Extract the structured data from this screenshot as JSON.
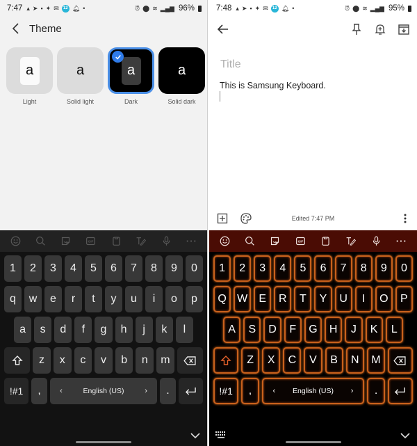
{
  "left": {
    "status_bar": {
      "time": "7:47",
      "battery": "96%"
    },
    "header": {
      "title": "Theme"
    },
    "themes": [
      {
        "label": "Light",
        "preview_char": "a",
        "selected": false
      },
      {
        "label": "Solid light",
        "preview_char": "a",
        "selected": false
      },
      {
        "label": "Dark",
        "preview_char": "a",
        "selected": true
      },
      {
        "label": "Solid dark",
        "preview_char": "a",
        "selected": false
      }
    ],
    "keyboard": {
      "toolbar": [
        "emoji-icon",
        "search-icon",
        "sticker-icon",
        "gif-icon",
        "clipboard-icon",
        "handwriting-icon",
        "mic-icon",
        "more-icon"
      ],
      "rows": [
        [
          "1",
          "2",
          "3",
          "4",
          "5",
          "6",
          "7",
          "8",
          "9",
          "0"
        ],
        [
          "q",
          "w",
          "e",
          "r",
          "t",
          "y",
          "u",
          "i",
          "o",
          "p"
        ],
        [
          "a",
          "s",
          "d",
          "f",
          "g",
          "h",
          "j",
          "k",
          "l"
        ],
        [
          "z",
          "x",
          "c",
          "v",
          "b",
          "n",
          "m"
        ]
      ],
      "symbols_label": "!#1",
      "comma": ",",
      "period": ".",
      "space_label": "English (US)",
      "space_prev": "‹",
      "space_next": "›"
    }
  },
  "right": {
    "status_bar": {
      "time": "7:48",
      "battery": "95%"
    },
    "note": {
      "title_placeholder": "Title",
      "body": "This is Samsung Keyboard.",
      "edited": "Edited 7:47 PM"
    },
    "keyboard": {
      "toolbar": [
        "emoji-icon",
        "search-icon",
        "sticker-icon",
        "gif-icon",
        "clipboard-icon",
        "handwriting-icon",
        "mic-icon",
        "more-icon"
      ],
      "rows": [
        [
          "1",
          "2",
          "3",
          "4",
          "5",
          "6",
          "7",
          "8",
          "9",
          "0"
        ],
        [
          "Q",
          "W",
          "E",
          "R",
          "T",
          "Y",
          "U",
          "I",
          "O",
          "P"
        ],
        [
          "A",
          "S",
          "D",
          "F",
          "G",
          "H",
          "J",
          "K",
          "L"
        ],
        [
          "Z",
          "X",
          "C",
          "V",
          "B",
          "N",
          "M"
        ]
      ],
      "symbols_label": "!#1",
      "comma": ",",
      "period": ".",
      "space_label": "English (US)",
      "space_prev": "‹",
      "space_next": "›"
    }
  },
  "colors": {
    "selection_accent": "#2f7be8",
    "neon_key_border": "#c8611c",
    "right_toolbar_bg": "#4a0c04"
  },
  "gif_text": "GIF",
  "dot_glyph": "•",
  "more_dots": "···"
}
